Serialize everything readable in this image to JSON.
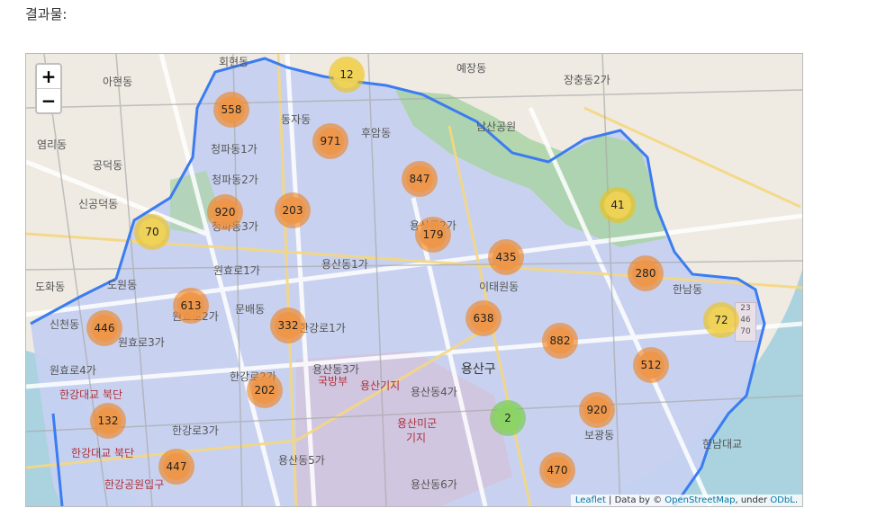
{
  "heading": "결과물:",
  "zoom": {
    "in": "+",
    "out": "−"
  },
  "clusters": [
    {
      "count": "558",
      "size": "large"
    },
    {
      "count": "12",
      "size": "medium"
    },
    {
      "count": "971",
      "size": "large"
    },
    {
      "count": "847",
      "size": "large"
    },
    {
      "count": "920",
      "size": "large"
    },
    {
      "count": "203",
      "size": "large"
    },
    {
      "count": "70",
      "size": "medium"
    },
    {
      "count": "179",
      "size": "large"
    },
    {
      "count": "41",
      "size": "medium"
    },
    {
      "count": "435",
      "size": "large"
    },
    {
      "count": "280",
      "size": "large"
    },
    {
      "count": "613",
      "size": "large"
    },
    {
      "count": "446",
      "size": "large"
    },
    {
      "count": "332",
      "size": "large"
    },
    {
      "count": "638",
      "size": "large"
    },
    {
      "count": "882",
      "size": "large"
    },
    {
      "count": "72",
      "size": "medium"
    },
    {
      "count": "512",
      "size": "large"
    },
    {
      "count": "202",
      "size": "large"
    },
    {
      "count": "132",
      "size": "large"
    },
    {
      "count": "2",
      "size": "small"
    },
    {
      "count": "920",
      "size": "large"
    },
    {
      "count": "447",
      "size": "large"
    },
    {
      "count": "470",
      "size": "large"
    }
  ],
  "place_labels": [
    "아현동",
    "염리동",
    "공덕동",
    "신공덕동",
    "도화동",
    "도원동",
    "원효로1가",
    "원효로2가",
    "원효로3가",
    "원효로4가",
    "청파동1가",
    "청파동2가",
    "청파동3가",
    "동자동",
    "후암동",
    "용산동2가",
    "용산동1가",
    "용산동3가",
    "용산동4가",
    "용산동5가",
    "용산동6가",
    "한강로1가",
    "한강로2가",
    "한강로3가",
    "문배동",
    "이태원동",
    "한남동",
    "보광동",
    "예장동",
    "장충동2가",
    "남산공원",
    "신천동",
    "국방부",
    "용산기지",
    "용산미군",
    "기지",
    "한남대교",
    "한강대교 북단",
    "한강대교 북단",
    "한강공원입구",
    "회현동",
    "용산구"
  ],
  "badge_lines": [
    "23",
    "46",
    "70"
  ],
  "attribution": {
    "leaflet": "Leaflet",
    "middle": " | Data by © ",
    "osm": "OpenStreetMap",
    "under": ", under ",
    "odbl": "ODbL",
    "end": "."
  }
}
